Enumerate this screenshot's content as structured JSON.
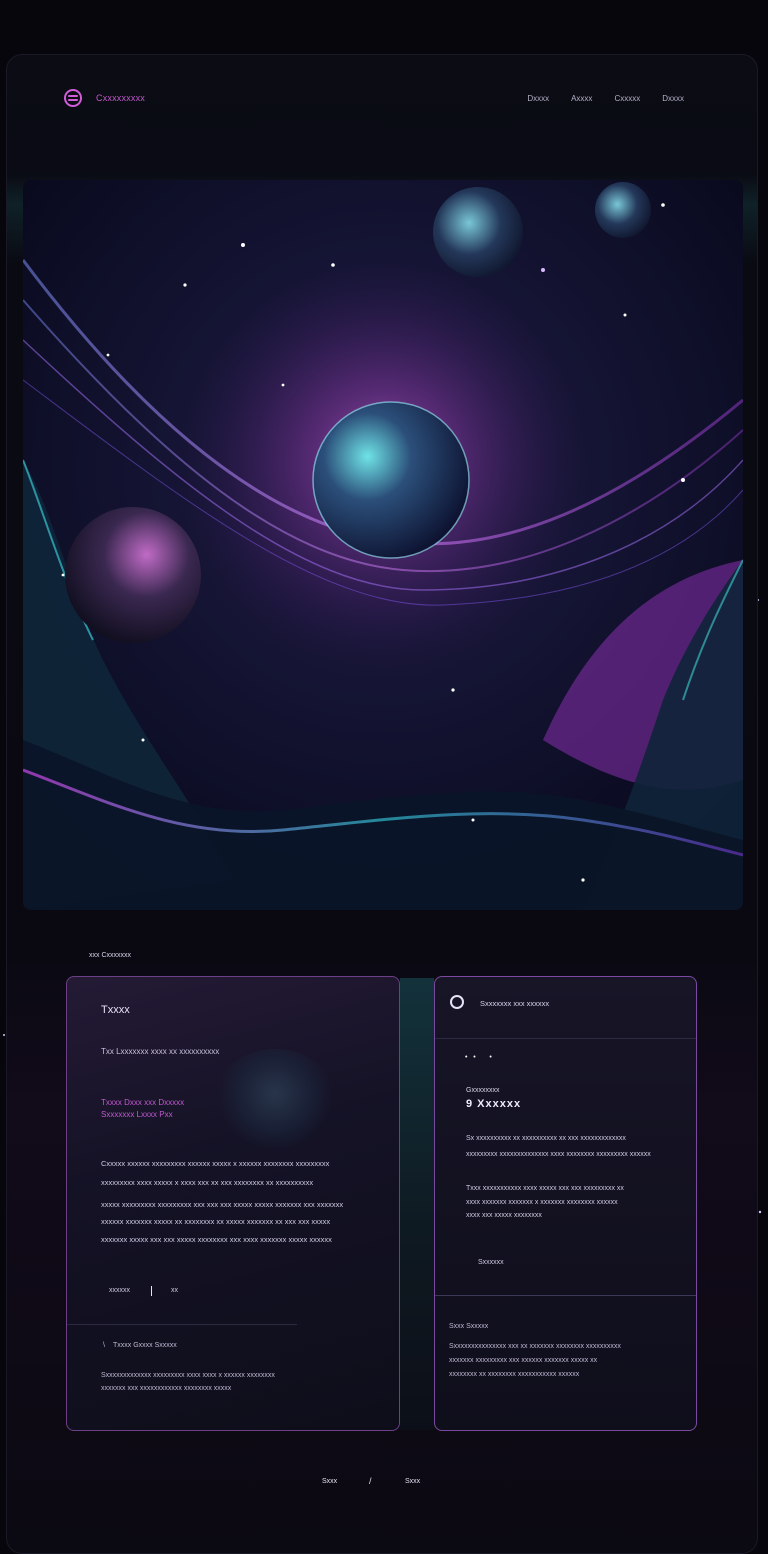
{
  "nav": {
    "brand": "Cxxxxxxxxx",
    "links": [
      "Dxxxx",
      "Axxxx",
      "Cxxxxx",
      "Dxxxx"
    ]
  },
  "section": {
    "label": "xxx Cxxxxxxx"
  },
  "left_card": {
    "title": "Txxxx",
    "subtitle": "Txx Lxxxxxxx xxxx xx xxxxxxxxxx",
    "highlight_line1": "Txxxx Dxxx xxx Dxxxxx",
    "highlight_line2": "Sxxxxxxx Lxxxx Pxx",
    "body_lines": [
      "Cxxxxx xxxxxx xxxxxxxxx xxxxxx xxxxx x xxxxxx xxxxxxxx xxxxxxxxx",
      "xxxxxxxxx xxxx xxxxx x xxxx xxx xx xxx xxxxxxxx xx xxxxxxxxxx",
      "xxxxx xxxxxxxxx xxxxxxxxx xxx xxx xxx xxxxx xxxxx xxxxxxx xxx xxxxxxx",
      "xxxxxx xxxxxxx xxxxx xx xxxxxxxx xx xxxxx xxxxxxx xx xxx xxx xxxxx",
      "xxxxxxx xxxxx xxx xxx xxxxx xxxxxxxx xxx xxxx xxxxxxx xxxxx xxxxxx"
    ],
    "action_left": "xxxxxx",
    "action_right": "xx",
    "footer_bullet": "Txxxx Gxxxx Sxxxxx",
    "footer_lines": [
      "Sxxxxxxxxxxxxx xxxxxxxxx xxxx xxxx x xxxxxx xxxxxxxx",
      "xxxxxxx xxx xxxxxxxxxxxx xxxxxxxx xxxxx"
    ]
  },
  "right_card": {
    "header": "Sxxxxxxx xxx xxxxxx",
    "small_label": "Gxxxxxxxx",
    "value": "9 Xxxxxx",
    "body_lines": [
      "Sx xxxxxxxxxx xx xxxxxxxxxx xx xxx xxxxxxxxxxxxx",
      "xxxxxxxxx xxxxxxxxxxxxxx xxxx xxxxxxxx xxxxxxxxx xxxxxx",
      "Txxx xxxxxxxxxxx xxxx xxxxx xxx xxx xxxxxxxxx xx",
      "xxxx xxxxxxx xxxxxxx x xxxxxxx xxxxxxxx xxxxxx",
      "xxxx xxx xxxxx xxxxxxxx"
    ],
    "link": "Sxxxxxx",
    "lower_label": "Sxxx Sxxxxx",
    "lower_lines": [
      "Sxxxxxxxxxxxxxxx xxx xx xxxxxxx xxxxxxxx xxxxxxxxxx",
      "xxxxxxx xxxxxxxxx xxx xxxxxx xxxxxxx xxxxx xx",
      "xxxxxxxx xx xxxxxxxx xxxxxxxxxxx xxxxxx"
    ]
  },
  "footer": {
    "left": "Sxxx",
    "mid": "/",
    "right": "Sxxx"
  },
  "colors": {
    "accent": "#d35cd8",
    "border": "#7a4aa0",
    "teal": "#1f5a63"
  }
}
